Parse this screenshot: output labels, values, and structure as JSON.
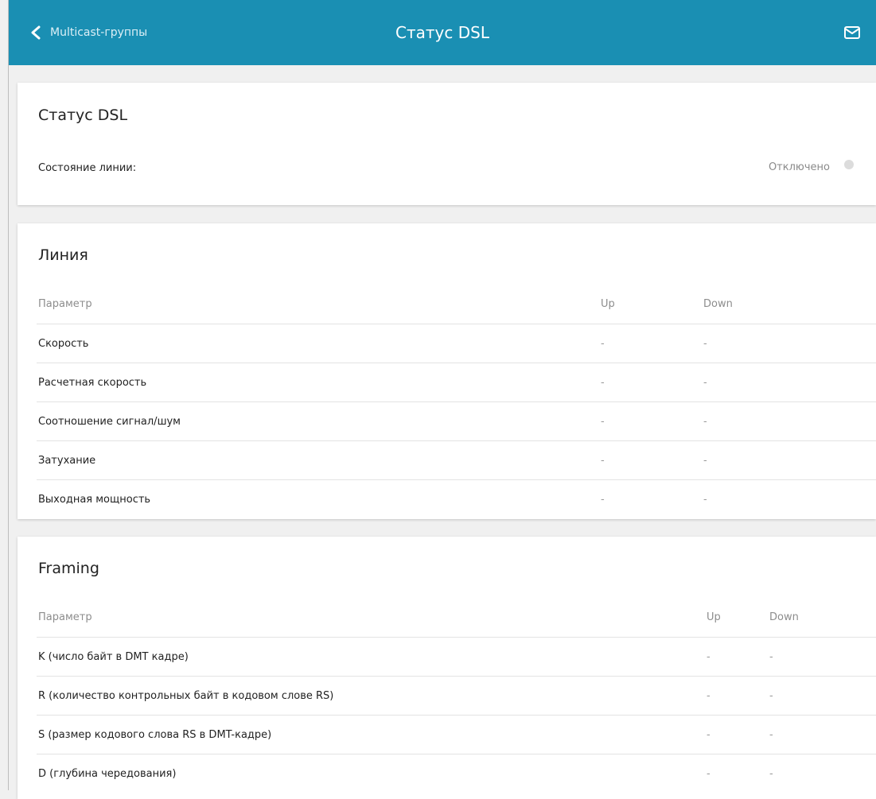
{
  "header": {
    "back_label": "Multicast-группы",
    "title": "Статус DSL"
  },
  "status_card": {
    "title": "Статус DSL",
    "line_state_label": "Состояние линии:",
    "line_state_value": "Отключено"
  },
  "line_card": {
    "title": "Линия",
    "columns": [
      "Параметр",
      "Up",
      "Down"
    ],
    "rows": [
      {
        "param": "Скорость",
        "up": "-",
        "down": "-"
      },
      {
        "param": "Расчетная скорость",
        "up": "-",
        "down": "-"
      },
      {
        "param": "Соотношение сигнал/шум",
        "up": "-",
        "down": "-"
      },
      {
        "param": "Затухание",
        "up": "-",
        "down": "-"
      },
      {
        "param": "Выходная мощность",
        "up": "-",
        "down": "-"
      }
    ]
  },
  "framing_card": {
    "title": "Framing",
    "columns": [
      "Параметр",
      "Up",
      "Down"
    ],
    "rows": [
      {
        "param": "K (число байт в DMT кадре)",
        "up": "-",
        "down": "-"
      },
      {
        "param": "R (количество контрольных байт в кодовом слове RS)",
        "up": "-",
        "down": "-"
      },
      {
        "param": "S (размер кодового слова RS в DMT-кадре)",
        "up": "-",
        "down": "-"
      },
      {
        "param": "D (глубина чередования)",
        "up": "-",
        "down": "-"
      }
    ]
  },
  "colors": {
    "header_bg": "#1a8fb3",
    "page_bg": "#f0f0f0",
    "status_dot": "#dcdcdc"
  },
  "icons": [
    "chevron-left-icon",
    "mail-icon",
    "status-dot-icon"
  ]
}
